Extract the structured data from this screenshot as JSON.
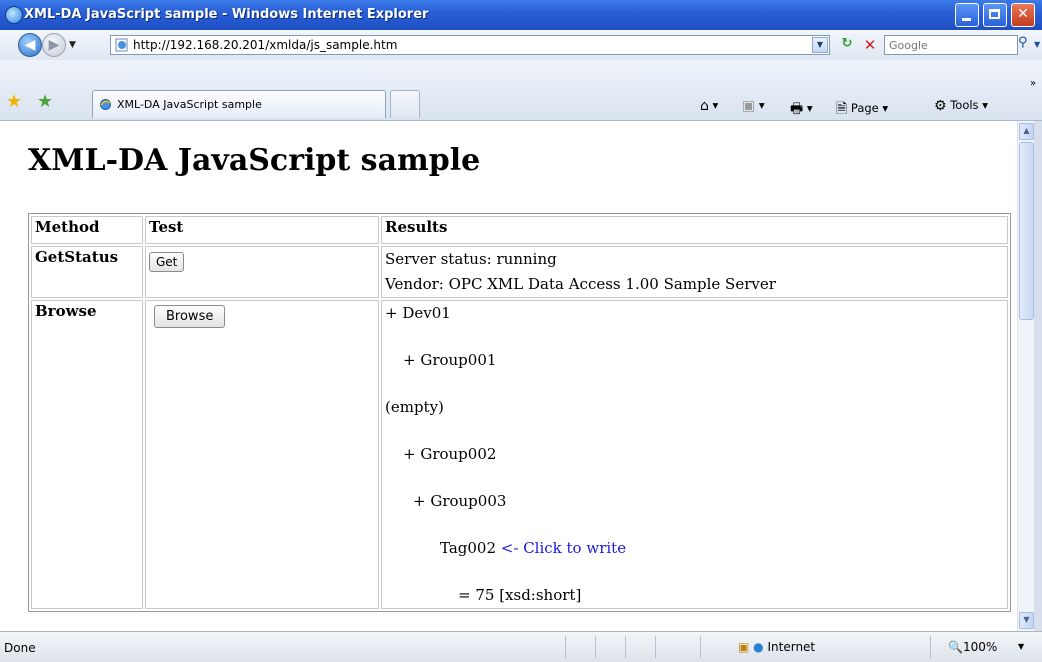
{
  "window": {
    "title": "XML-DA JavaScript sample - Windows Internet Explorer"
  },
  "addressbar": {
    "url": "http://192.168.20.201/xmlda/js_sample.htm",
    "search_placeholder": "Google"
  },
  "tabs": [
    {
      "label": "XML-DA JavaScript sample"
    }
  ],
  "commandbar": {
    "page_label": "Page",
    "tools_label": "Tools"
  },
  "page": {
    "heading": "XML-DA JavaScript sample",
    "table": {
      "headers": [
        "Method",
        "Test",
        "Results"
      ],
      "rows": [
        {
          "method": "GetStatus",
          "button": "Get",
          "results": [
            "Server status: running",
            "Vendor: OPC XML Data Access 1.00 Sample Server"
          ]
        },
        {
          "method": "Browse",
          "button": "Browse",
          "results": [
            "+ Dev01",
            "+ Group001",
            "(empty)",
            "+ Group002",
            "+ Group003",
            "Tag002",
            "= 75 [xsd:short]"
          ],
          "write_link": "<- Click to write"
        }
      ]
    }
  },
  "statusbar": {
    "status": "Done",
    "zone": "Internet",
    "zoom": "100%"
  },
  "colors": {
    "titlebar": "#2a5fd6",
    "link": "#1a1ad8"
  }
}
